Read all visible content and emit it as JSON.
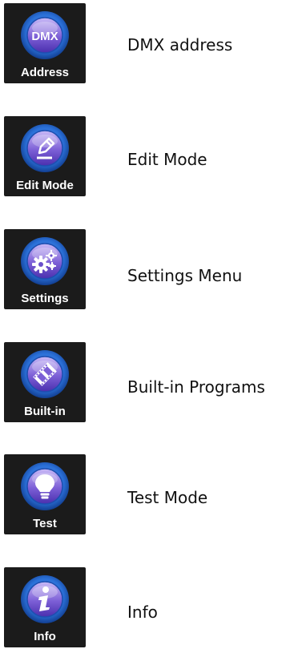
{
  "colors": {
    "tile_bg": "#1b1b1b",
    "ring_outer": "#2a6fd6",
    "ring_inner": "#1e4fb0",
    "disc_top": "#b7a6f0",
    "disc_bottom": "#5a3fc2",
    "label_text": "#ffffff",
    "description_text": "#111111"
  },
  "items": [
    {
      "icon": "dmx-icon",
      "icon_text": "DMX",
      "tile_label": "Address",
      "description": "DMX address"
    },
    {
      "icon": "pencil-icon",
      "tile_label": "Edit Mode",
      "description": "Edit Mode"
    },
    {
      "icon": "gears-icon",
      "tile_label": "Settings",
      "description": "Settings Menu"
    },
    {
      "icon": "film-icon",
      "tile_label": "Built-in",
      "description": "Built-in Programs"
    },
    {
      "icon": "lightbulb-icon",
      "tile_label": "Test",
      "description": "Test Mode"
    },
    {
      "icon": "info-icon",
      "tile_label": "Info",
      "description": "Info"
    }
  ]
}
